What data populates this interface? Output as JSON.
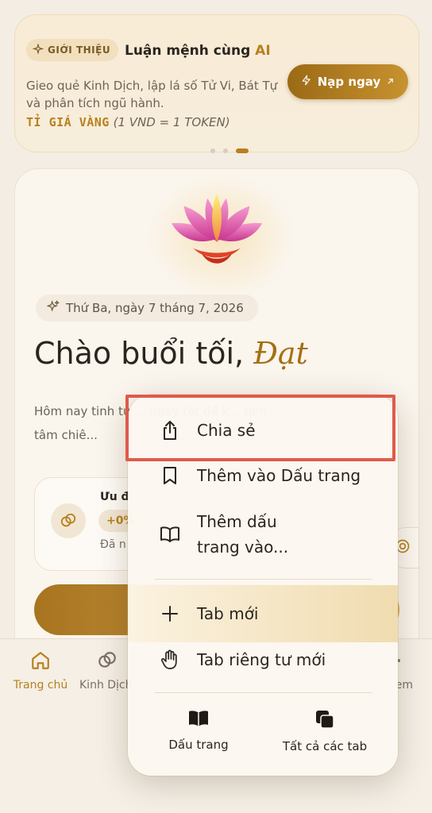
{
  "promo": {
    "badge": "GIỚI THIỆU",
    "title_prefix": "Luận mệnh cùng ",
    "title_ai": "AI",
    "description": "Gieo quẻ Kinh Dịch, lập lá số Tử Vi, Bát Tự và phân tích ngũ hành.",
    "rate_label": "TỈ GIÁ VÀNG",
    "rate_value": "(1 VND = 1 TOKEN)",
    "button_label": "Nạp ngay",
    "slides": 3,
    "active_slide": 3
  },
  "hero": {
    "date": "Thứ Ba, ngày 7 tháng 7, 2026",
    "greeting_prefix": "Chào buổi tối, ",
    "greeting_name": "Đạt",
    "description": "Hôm nay tinh tú ... ngày tốt để k... tịnh tâm chiê...",
    "offer_title": "Ưu đ",
    "offer_pill": "+0%",
    "offer_sub": "Đã n"
  },
  "nav": {
    "home": "Trang chủ",
    "kinh_dich": "Kinh Dịch",
    "more_suffix": "em"
  },
  "menu": {
    "share": "Chia sẻ",
    "add_bookmark": "Thêm vào Dấu trang",
    "add_to_homescreen": "Thêm dấu trang vào...",
    "new_tab": "Tab mới",
    "new_private_tab": "Tab riêng tư mới",
    "bookmarks": "Dấu trang",
    "all_tabs": "Tất cả các tab"
  },
  "colors": {
    "accent_gold": "#b8801f",
    "highlight_red": "#e05a4a",
    "background": "#f3ede4"
  },
  "icons": {
    "badge": "sparkle-icon",
    "topup": "lightning-icon",
    "share": "share-icon",
    "bookmark": "bookmark-icon",
    "book": "book-open-icon",
    "new_tab": "plus-icon",
    "private": "hand-icon",
    "all_tabs": "tabs-icon"
  }
}
